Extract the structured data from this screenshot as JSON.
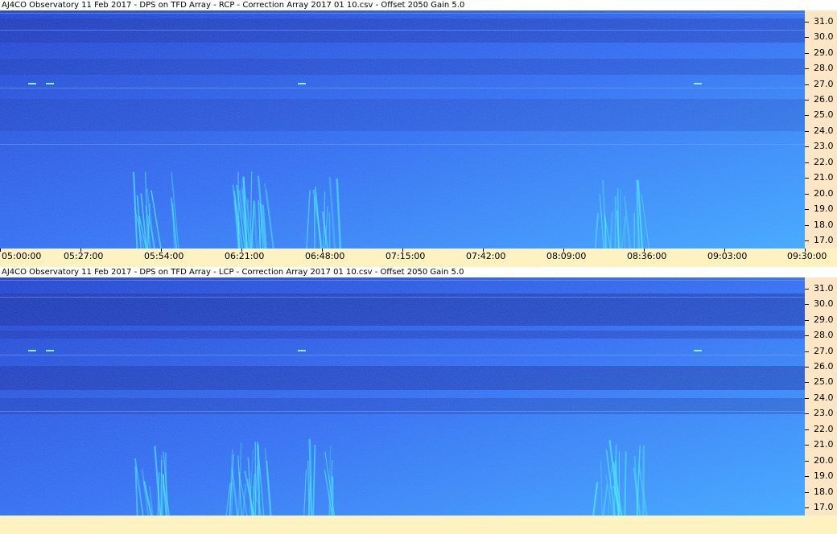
{
  "colors": {
    "dark": "#1836c8",
    "mid": "#2a66f0",
    "bright": "#3aa8ff",
    "burst": "#4ff0ff",
    "yaxis_bg": "#fde6c6",
    "xaxis_bg": "#fdf2c0"
  },
  "chart_data": [
    {
      "type": "heatmap",
      "title": "AJ4CO Observatory 11 Feb 2017  -  DPS on TFD Array  -  RCP  -  Correction Array 2017 01 10.csv  -  Offset 2050  Gain 5.0",
      "xlabel": "",
      "ylabel": "",
      "x_tick_labels": [
        "05:00:00",
        "05:27:00",
        "05:54:00",
        "06:21:00",
        "06:48:00",
        "07:15:00",
        "07:42:00",
        "08:09:00",
        "08:36:00",
        "09:03:00",
        "09:30:00"
      ],
      "y_tick_labels": [
        "31.0",
        "30.0",
        "29.0",
        "28.0",
        "27.0",
        "26.0",
        "25.0",
        "24.0",
        "23.0",
        "22.0",
        "21.0",
        "20.0",
        "19.0",
        "18.0",
        "17.0"
      ],
      "ylim": [
        16.5,
        31.7
      ],
      "grid": false
    },
    {
      "type": "heatmap",
      "title": "AJ4CO Observatory 11 Feb 2017  -  DPS on TFD Array  -  LCP  -  Correction Array 2017 01 10.csv  -  Offset 2050  Gain 5.0",
      "xlabel": "",
      "ylabel": "",
      "x_tick_labels": [],
      "y_tick_labels": [
        "31.0",
        "30.0",
        "29.0",
        "28.0",
        "27.0",
        "26.0",
        "25.0",
        "24.0",
        "23.0",
        "22.0",
        "21.0",
        "20.0",
        "19.0",
        "18.0",
        "17.0"
      ],
      "ylim": [
        16.5,
        31.7
      ],
      "grid": false
    }
  ]
}
